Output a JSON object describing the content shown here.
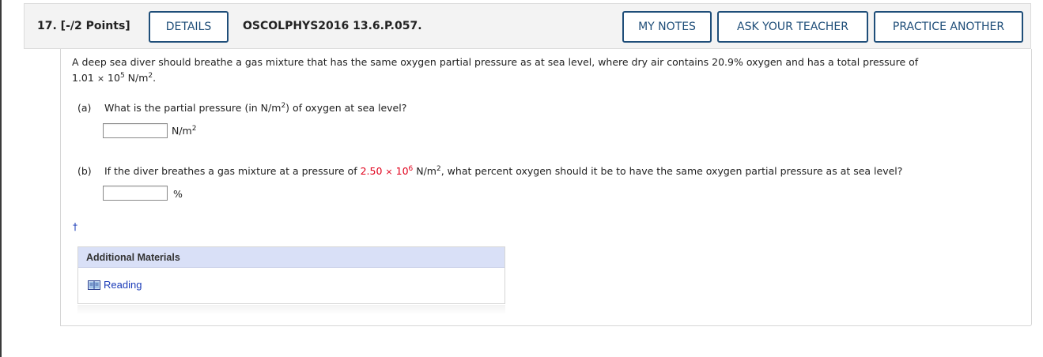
{
  "header": {
    "question_number": "17. [-/2 Points]",
    "details_label": "DETAILS",
    "problem_code": "OSCOLPHYS2016 13.6.P.057.",
    "my_notes_label": "MY NOTES",
    "ask_teacher_label": "ASK YOUR TEACHER",
    "practice_another_label": "PRACTICE ANOTHER"
  },
  "question": {
    "intro_line1": "A deep sea diver should breathe a gas mixture that has the same oxygen partial pressure as at sea level, where dry air contains 20.9% oxygen and has a total pressure of",
    "intro_value": "1.01",
    "intro_times": "×",
    "intro_base": "10",
    "intro_exp": "5",
    "intro_unit": "N/m",
    "intro_unit_exp": "2",
    "intro_end": "."
  },
  "part_a": {
    "label": "(a)",
    "text_before": "What is the partial pressure (in N/m",
    "text_exp": "2",
    "text_after": ") of oxygen at sea level?",
    "answer_value": "",
    "unit": "N/m",
    "unit_exp": "2"
  },
  "part_b": {
    "label": "(b)",
    "text_before": "If the diver breathes a gas mixture at a pressure of",
    "value": "2.50",
    "times": "×",
    "base": "10",
    "exp": "6",
    "unit_text": "N/m",
    "unit_exp": "2",
    "text_after": ", what percent oxygen should it be to have the same oxygen partial pressure as at sea level?",
    "answer_value": "",
    "unit": "%"
  },
  "dagger": "†",
  "additional_materials": {
    "title": "Additional Materials",
    "reading_label": "Reading"
  },
  "colors": {
    "accent": "#1f4e79",
    "highlight_red": "#e0001b",
    "materials_header": "#d9e0f7",
    "link": "#1a3bb8"
  }
}
